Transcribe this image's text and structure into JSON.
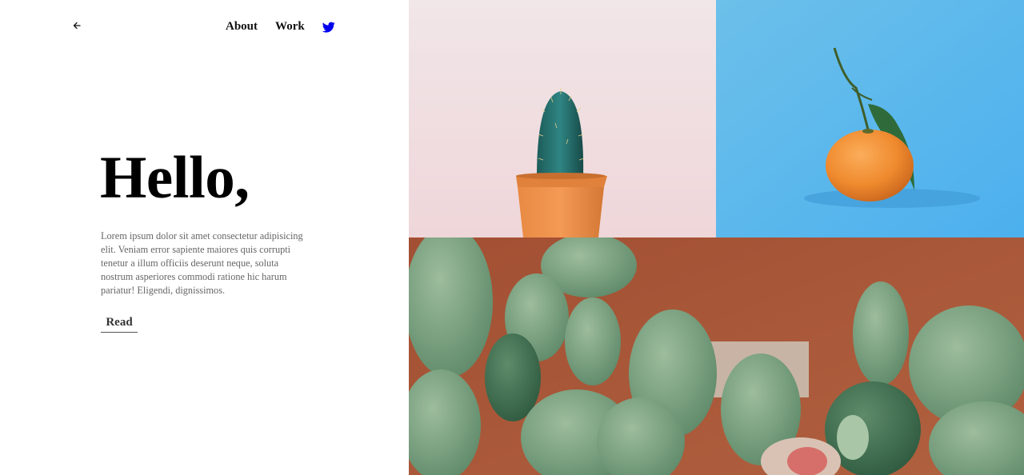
{
  "header": {
    "back_icon": "arrow-left-icon",
    "nav": [
      {
        "label": "About"
      },
      {
        "label": "Work"
      }
    ],
    "social_icon": "twitter-icon",
    "social_color": "#0000ee"
  },
  "hero": {
    "title": "Hello,",
    "body": "Lorem ipsum dolor sit amet consectetur adipisicing elit. Veniam error sapiente maiores quis corrupti tenetur a illum officiis deserunt neque, soluta nostrum asperiores commodi ratione hic harum pariatur! Eligendi, dignissimos.",
    "read_label": "Read"
  },
  "gallery": {
    "images": [
      {
        "subject": "potted cactus on pink background",
        "background": "#f3e4e6"
      },
      {
        "subject": "mandarin orange with leaves on blue background",
        "background": "#5eb9ec"
      },
      {
        "subject": "prickly pear cacti against terracotta wall",
        "background": "#a6563a"
      }
    ]
  }
}
